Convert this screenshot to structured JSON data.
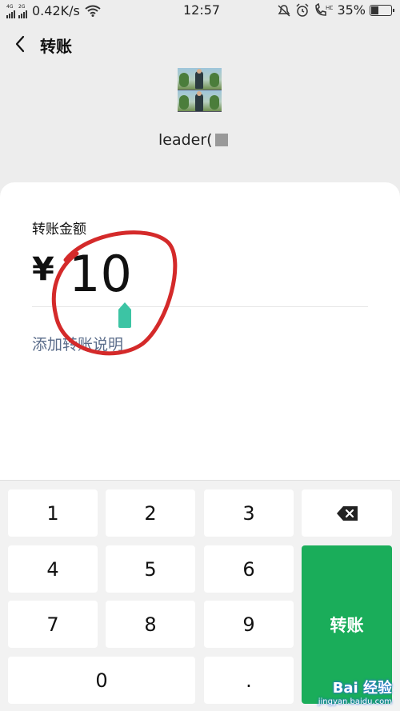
{
  "status_bar": {
    "network_speed": "0.42K/s",
    "time": "12:57",
    "battery": "35%",
    "sim1_label": "4G",
    "sim2_label": "2G",
    "hd_label": "HD"
  },
  "nav": {
    "title": "转账"
  },
  "recipient": {
    "name": "leader("
  },
  "amount": {
    "label": "转账金额",
    "currency": "¥",
    "value": "10",
    "add_note": "添加转账说明"
  },
  "keypad": {
    "keys": [
      "1",
      "2",
      "3",
      "4",
      "5",
      "6",
      "7",
      "8",
      "9",
      "0",
      "."
    ],
    "transfer_label": "转账",
    "transfer_color": "#1aad5a"
  },
  "watermark": {
    "brand": "Bai 经验",
    "url": "jingyan.baidu.com"
  },
  "annotation_color": "#d42a2a"
}
